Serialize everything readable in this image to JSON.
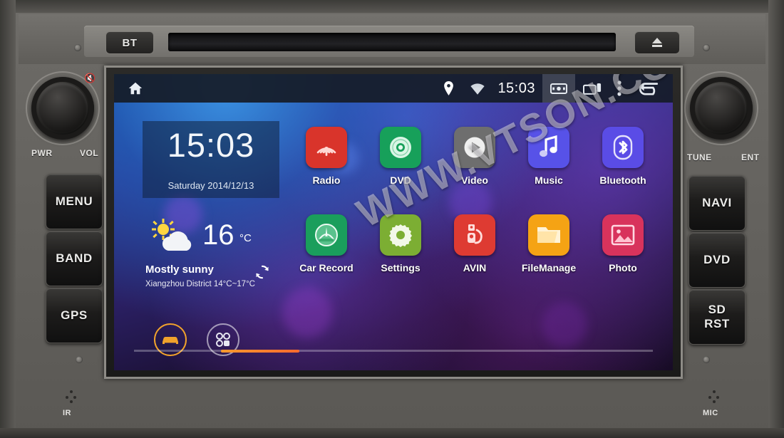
{
  "device": {
    "top_bar": {
      "bt_button": "BT",
      "eject_icon": "eject-icon"
    },
    "left_controls": {
      "knob_left_label": "PWR",
      "knob_right_label": "VOL",
      "mute_icon": "mute-icon",
      "buttons": [
        "MENU",
        "BAND",
        "GPS"
      ]
    },
    "right_controls": {
      "knob_left_label": "TUNE",
      "knob_right_label": "ENT",
      "buttons": [
        "NAVI",
        "DVD",
        "SD\nRST"
      ]
    },
    "bottom_labels": {
      "ir": "IR",
      "mic": "MIC"
    }
  },
  "screen": {
    "statusbar": {
      "home_icon": "home-icon",
      "location_icon": "location-pin-icon",
      "wifi_icon": "wifi-icon",
      "time": "15:03",
      "screenshot_icon": "screenshot-icon",
      "recents_icon": "recent-apps-icon",
      "overflow_icon": "overflow-menu-icon",
      "back_icon": "back-arrow-icon"
    },
    "clock_widget": {
      "time": "15:03",
      "date": "Saturday 2014/12/13"
    },
    "weather_widget": {
      "icon": "sun-cloud-icon",
      "temperature": "16",
      "unit": "°C",
      "condition": "Mostly sunny",
      "location_range": "Xiangzhou District 14°C~17°C",
      "refresh_icon": "refresh-icon"
    },
    "dock": [
      {
        "name": "car-shortcut",
        "icon": "car-icon"
      },
      {
        "name": "app-drawer",
        "icon": "apps-grid-icon"
      }
    ],
    "apps": [
      {
        "label": "Radio",
        "icon": "radio-icon",
        "color": "#d9342b"
      },
      {
        "label": "DVD",
        "icon": "disc-icon",
        "color": "#17a05a"
      },
      {
        "label": "Video",
        "icon": "play-icon",
        "color": "#6e6e6e"
      },
      {
        "label": "Music",
        "icon": "music-note-icon",
        "color": "#5752e8"
      },
      {
        "label": "Bluetooth",
        "icon": "bluetooth-icon",
        "color": "#5a4ce6"
      },
      {
        "label": "Car Record",
        "icon": "dashcam-icon",
        "color": "#1a9e5c"
      },
      {
        "label": "Settings",
        "icon": "gear-icon",
        "color": "#7cae33"
      },
      {
        "label": "AVIN",
        "icon": "avin-plug-icon",
        "color": "#de3b32"
      },
      {
        "label": "FileManage",
        "icon": "folder-icon",
        "color": "#f5a314"
      },
      {
        "label": "Photo",
        "icon": "picture-icon",
        "color": "#d8335c"
      }
    ],
    "page_indicator": {
      "pages": 4,
      "active": 1
    }
  },
  "watermark": {
    "text": "WWW.VTSON.CO.UK"
  }
}
